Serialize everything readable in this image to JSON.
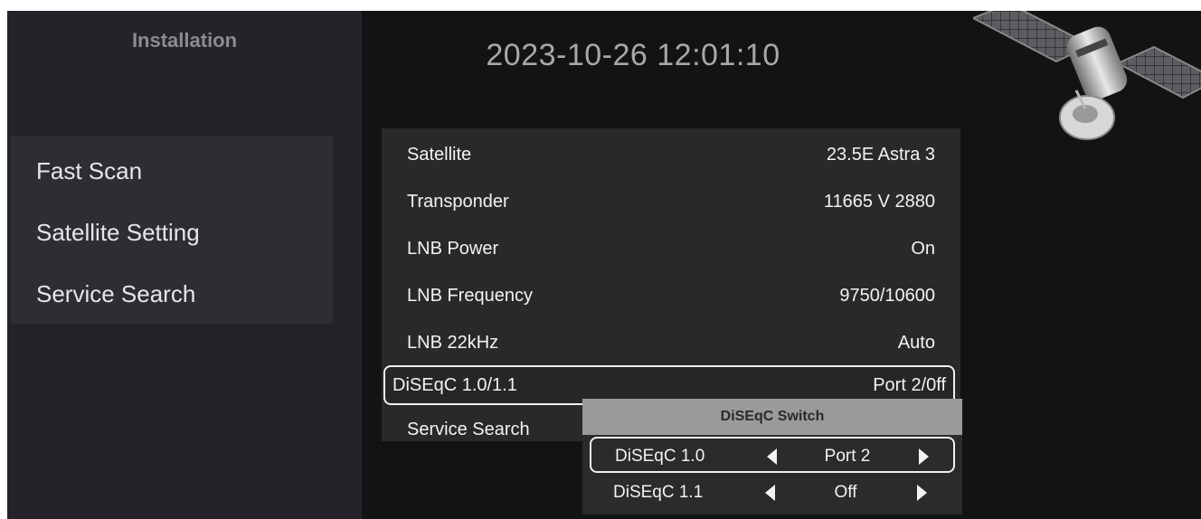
{
  "sidebar": {
    "title": "Installation",
    "items": [
      {
        "label": "Fast Scan"
      },
      {
        "label": "Satellite Setting"
      },
      {
        "label": "Service Search"
      }
    ]
  },
  "header": {
    "datetime": "2023-10-26 12:01:10",
    "illustration_icon": "satellite-icon"
  },
  "settings": {
    "rows": [
      {
        "label": "Satellite",
        "value": "23.5E Astra 3"
      },
      {
        "label": "Transponder",
        "value": "11665 V 2880"
      },
      {
        "label": "LNB Power",
        "value": "On"
      },
      {
        "label": "LNB Frequency",
        "value": "9750/10600"
      },
      {
        "label": "LNB 22kHz",
        "value": "Auto"
      },
      {
        "label": "DiSEqC 1.0/1.1",
        "value": "Port 2/0ff"
      },
      {
        "label": "Service Search",
        "value": ""
      }
    ],
    "selected_index": 5
  },
  "popup": {
    "title": "DiSEqC Switch",
    "rows": [
      {
        "label": "DiSEqC 1.0",
        "value": "Port 2"
      },
      {
        "label": "DiSEqC 1.1",
        "value": "Off"
      }
    ],
    "selected_index": 0
  },
  "colors": {
    "screen_bg": "#121314",
    "sidebar_bg": "#252329",
    "panel_bg": "#29292b",
    "popup_header_bg": "#9a9a9a",
    "highlight_border": "#f0f0f0"
  }
}
